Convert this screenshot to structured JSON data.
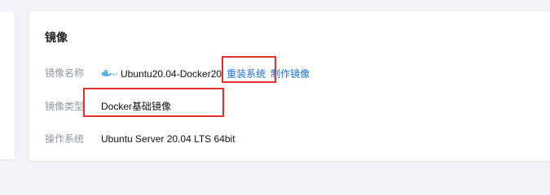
{
  "section": {
    "title": "镜像"
  },
  "rows": [
    {
      "label": "镜像名称",
      "value": "Ubuntu20.04-Docker20",
      "logo_icon": "docker-icon",
      "actions": [
        {
          "label": "重装系统"
        },
        {
          "label": "制作镜像"
        }
      ]
    },
    {
      "label": "镜像类型",
      "value": "Docker基础镜像"
    },
    {
      "label": "操作系统",
      "value": "Ubuntu Server 20.04 LTS 64bit"
    }
  ],
  "colors": {
    "link": "#1f6fd6",
    "label": "#8f96a3",
    "highlight": "#e0312b",
    "docker_blue": "#2496ed"
  }
}
